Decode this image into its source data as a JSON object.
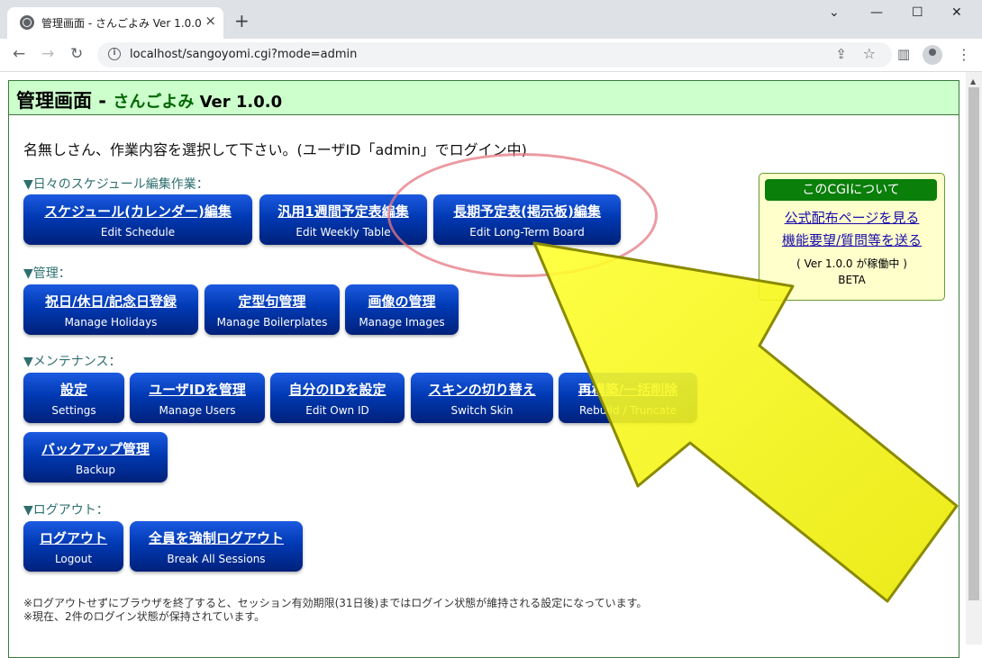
{
  "browser": {
    "tab_title": "管理画面 - さんごよみ Ver 1.0.0",
    "tab_close": "×",
    "new_tab": "+",
    "url": "localhost/sangoyomi.cgi?mode=admin",
    "window_minimize": "—",
    "window_maximize": "☐",
    "window_close": "✕"
  },
  "page": {
    "title_main": "管理画面",
    "title_sep": " - ",
    "app_name": "さんごよみ",
    "version": " Ver 1.0.0",
    "greeting": "名無しさん、作業内容を選択して下さい。(ユーザID「admin」でログイン中)",
    "sections": {
      "schedule": "▼日々のスケジュール編集作業：",
      "manage": "▼管理：",
      "maintenance": "▼メンテナンス：",
      "logout": "▼ログアウト："
    },
    "buttons": {
      "edit_schedule": {
        "jp": "スケジュール(カレンダー)編集",
        "en": "Edit Schedule"
      },
      "edit_weekly": {
        "jp": "汎用1週間予定表編集",
        "en": "Edit Weekly Table"
      },
      "edit_longterm": {
        "jp": "長期予定表(掲示板)編集",
        "en": "Edit Long-Term Board"
      },
      "holidays": {
        "jp": "祝日/休日/記念日登録",
        "en": "Manage Holidays"
      },
      "boilerplates": {
        "jp": "定型句管理",
        "en": "Manage Boilerplates"
      },
      "images": {
        "jp": "画像の管理",
        "en": "Manage Images"
      },
      "settings": {
        "jp": "設定",
        "en": "Settings"
      },
      "users": {
        "jp": "ユーザIDを管理",
        "en": "Manage Users"
      },
      "own_id": {
        "jp": "自分のIDを設定",
        "en": "Edit Own ID"
      },
      "skin": {
        "jp": "スキンの切り替え",
        "en": "Switch Skin"
      },
      "rebuild": {
        "jp": "再構築/一括削除",
        "en": "Rebuild / Truncate"
      },
      "backup": {
        "jp": "バックアップ管理",
        "en": "Backup"
      },
      "logout": {
        "jp": "ログアウト",
        "en": "Logout"
      },
      "break_sessions": {
        "jp": "全員を強制ログアウト",
        "en": "Break All Sessions"
      }
    },
    "aside": {
      "heading": "このCGIについて",
      "link1": "公式配布ページを見る",
      "link2": "機能要望/質問等を送る",
      "running": "( Ver 1.0.0 が稼働中 )",
      "beta": "BETA"
    },
    "notes": [
      "※ログアウトせずにブラウザを終了すると、セッション有効期限(31日後)まではログイン状態が維持される設定になっています。",
      "※現在、2件のログイン状態が保持されています。"
    ]
  },
  "colors": {
    "button": "#0039b3",
    "header_bg": "#ccffcc",
    "app_name": "#006600",
    "aside_bg": "#ffffcc",
    "aside_head": "#0a7f0a",
    "highlight_arrow": "#f0f020",
    "highlight_ellipse": "#e67882"
  }
}
